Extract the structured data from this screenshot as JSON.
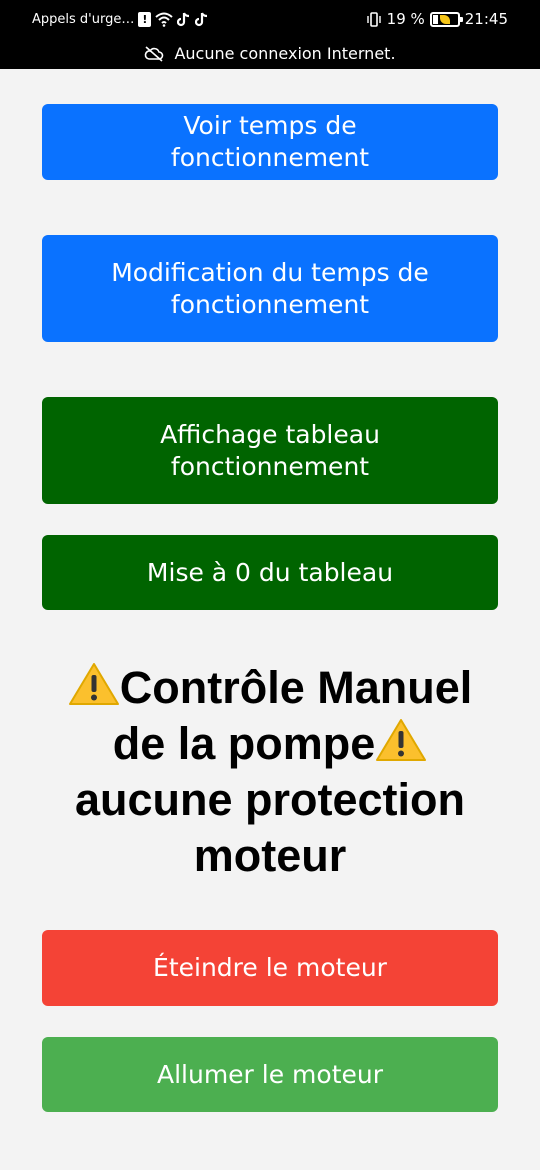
{
  "status_bar": {
    "carrier": "Appels d'urge…",
    "battery_percent": "19 %",
    "time": "21:45",
    "battery_level": 0.19
  },
  "banner": {
    "text": "Aucune connexion Internet."
  },
  "buttons": {
    "view_runtime": "Voir temps de fonctionnement",
    "edit_runtime": "Modification du temps de fonctionnement",
    "show_table": "Affichage tableau fonctionnement",
    "reset_table": "Mise à 0 du tableau",
    "stop_motor": "Éteindre le moteur",
    "start_motor": "Allumer le moteur"
  },
  "warning": {
    "line1": "Contrôle Manuel",
    "line2": "de la pompe",
    "line3": "aucune protection moteur"
  },
  "colors": {
    "blue": "#0a72ff",
    "dark_green": "#006400",
    "red": "#f44336",
    "green": "#4caf50",
    "warning_yellow": "#fbc02d"
  },
  "icons": [
    "alert-icon",
    "wifi-icon",
    "tiktok-icon",
    "vibrate-icon",
    "battery-icon",
    "cloud-off-icon",
    "warning-icon"
  ]
}
